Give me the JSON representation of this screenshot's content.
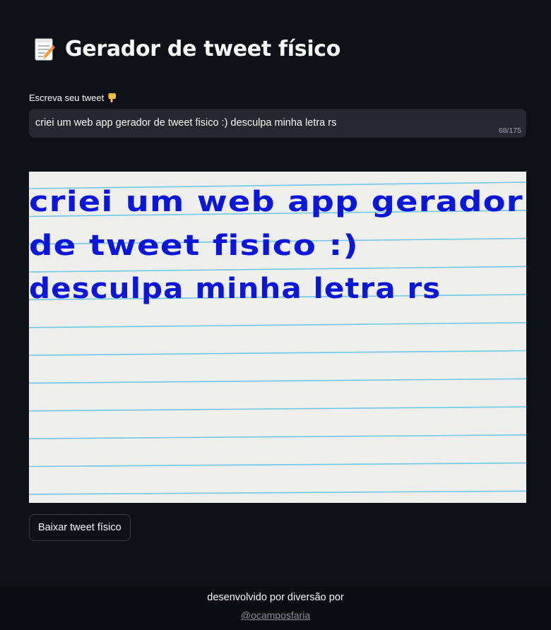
{
  "header": {
    "icon": "memo-icon",
    "title": "Gerador de tweet físico"
  },
  "tweet_input": {
    "label": "Escreva seu tweet",
    "label_icon": "backhand-index-pointing-down-icon",
    "value": "criei um web app gerador de tweet fisico :) desculpa minha letra rs",
    "char_count": "68/175"
  },
  "generated_image": {
    "lines": [
      "criei um web app gerador",
      "de tweet fisico :)",
      "desculpa minha letra rs"
    ],
    "ink_color": "#0a16d8",
    "rule_color": "#6ec8e8",
    "paper_color": "#eeeeec"
  },
  "download_button": {
    "label": "Baixar tweet físico"
  },
  "footer": {
    "text": "desenvolvido por diversão por",
    "link": "@ocamposfaria"
  }
}
